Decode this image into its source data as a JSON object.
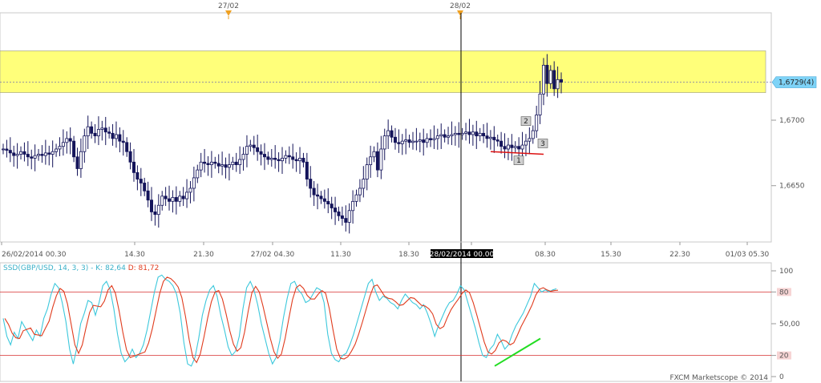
{
  "chart_data": [
    {
      "type": "candlestick",
      "instrument": "GBP/USD",
      "date_markers": [
        "27/02",
        "28/02"
      ],
      "time_labels": [
        "26/02/2014 00.30",
        "14.30",
        "21.30",
        "27/02 04.30",
        "11.30",
        "18.30",
        "28/02/2014 00.00",
        "08.30",
        "15.30",
        "22.30",
        "01/03 05.30"
      ],
      "y_ticks": [
        "1,6650",
        "1,6700"
      ],
      "price_label": "1,6729(4)",
      "ylim": [
        1.6607,
        1.6782
      ],
      "resistance_zone": [
        1.6721,
        1.6753
      ],
      "support_line": 1.6676,
      "pattern_labels": [
        "1",
        "2",
        "3"
      ],
      "close_prices": [
        1.6678,
        1.6677,
        1.6675,
        1.6673,
        1.6674,
        1.6676,
        1.6674,
        1.6672,
        1.6671,
        1.6673,
        1.6674,
        1.6673,
        1.6675,
        1.6674,
        1.6676,
        1.6678,
        1.668,
        1.6683,
        1.6686,
        1.6684,
        1.6672,
        1.6663,
        1.6676,
        1.6688,
        1.6695,
        1.669,
        1.6688,
        1.6693,
        1.6694,
        1.6691,
        1.669,
        1.6686,
        1.6689,
        1.6684,
        1.6683,
        1.6676,
        1.6668,
        1.666,
        1.6655,
        1.6652,
        1.6646,
        1.6639,
        1.663,
        1.6628,
        1.6635,
        1.6642,
        1.664,
        1.6638,
        1.6641,
        1.6638,
        1.6642,
        1.664,
        1.6645,
        1.6648,
        1.6656,
        1.6662,
        1.6668,
        1.6667,
        1.6666,
        1.6668,
        1.6667,
        1.6665,
        1.6666,
        1.6664,
        1.6666,
        1.6668,
        1.6666,
        1.667,
        1.6674,
        1.668,
        1.6681,
        1.6679,
        1.6676,
        1.6674,
        1.6672,
        1.667,
        1.6671,
        1.667,
        1.6669,
        1.6671,
        1.6673,
        1.6672,
        1.667,
        1.6669,
        1.6671,
        1.6668,
        1.6655,
        1.6648,
        1.6643,
        1.6642,
        1.664,
        1.6638,
        1.6636,
        1.6633,
        1.663,
        1.6627,
        1.6625,
        1.6622,
        1.6631,
        1.6638,
        1.6643,
        1.6648,
        1.6655,
        1.6666,
        1.6672,
        1.6676,
        1.6662,
        1.6678,
        1.6688,
        1.6692,
        1.6687,
        1.6683,
        1.6682,
        1.6684,
        1.6685,
        1.6683,
        1.6684,
        1.6684,
        1.6685,
        1.6683,
        1.6686,
        1.6685,
        1.6686,
        1.6688,
        1.6689,
        1.6687,
        1.6688,
        1.6689,
        1.669,
        1.6689,
        1.669,
        1.6691,
        1.6689,
        1.6691,
        1.6688,
        1.669,
        1.6688,
        1.6686,
        1.6687,
        1.6685,
        1.6684,
        1.668,
        1.6678,
        1.6681,
        1.6679,
        1.668,
        1.6678,
        1.6681,
        1.6684,
        1.6686,
        1.6692,
        1.6704,
        1.672,
        1.6742,
        1.6728,
        1.6738,
        1.6724,
        1.6731,
        1.6729
      ],
      "indicator": {
        "name": "SSD(GBP/USD, 14, 3, 3)",
        "k_label": "K: 82,64",
        "d_label": "D: 81,72",
        "y_ticks": [
          "100",
          "80",
          "50,00",
          "20",
          "0"
        ],
        "levels": [
          80,
          20
        ],
        "ylim": [
          0,
          100
        ],
        "k_values": [
          55,
          38,
          30,
          42,
          36,
          52,
          46,
          40,
          34,
          44,
          38,
          55,
          64,
          78,
          88,
          84,
          70,
          52,
          26,
          12,
          28,
          50,
          60,
          72,
          70,
          58,
          70,
          86,
          90,
          82,
          64,
          40,
          22,
          14,
          18,
          26,
          18,
          22,
          30,
          44,
          62,
          80,
          94,
          96,
          92,
          90,
          86,
          78,
          60,
          32,
          12,
          10,
          18,
          36,
          58,
          72,
          82,
          86,
          76,
          58,
          44,
          28,
          20,
          24,
          38,
          64,
          84,
          90,
          82,
          68,
          50,
          36,
          22,
          12,
          18,
          34,
          56,
          74,
          88,
          90,
          82,
          78,
          70,
          72,
          78,
          84,
          82,
          70,
          40,
          22,
          16,
          14,
          20,
          22,
          30,
          40,
          52,
          64,
          76,
          88,
          92,
          80,
          72,
          76,
          74,
          70,
          68,
          64,
          72,
          78,
          74,
          70,
          68,
          64,
          68,
          60,
          50,
          38,
          48,
          56,
          64,
          70,
          72,
          78,
          86,
          82,
          70,
          58,
          46,
          32,
          20,
          18,
          26,
          30,
          40,
          34,
          26,
          30,
          40,
          48,
          54,
          60,
          68,
          76,
          88,
          84,
          80,
          82,
          80,
          82,
          83
        ]
      },
      "footer": "FXCM Marketscope © 2014"
    }
  ],
  "colors": {
    "candle": "#14145a",
    "zone_fill": "#ffff7a",
    "support": "#dd1111",
    "k_line": "#3cc8dc",
    "d_line": "#e03c1e",
    "levels": "#d73030",
    "divergence": "#22dd22",
    "price_tag": "#7ed3f7",
    "marker": "#f0a020"
  }
}
